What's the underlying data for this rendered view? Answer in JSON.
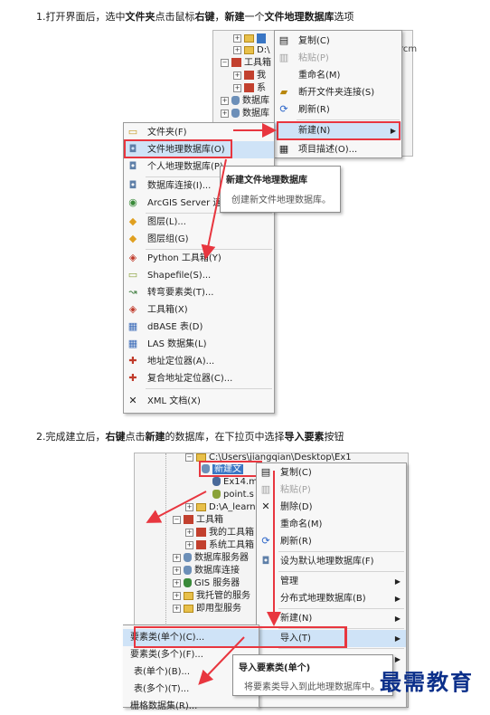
{
  "step1": {
    "caption_parts": [
      "1.打开界面后，选中",
      "文件夹",
      "点击鼠标",
      "右键",
      "，",
      "新建",
      "一个",
      "文件地理数据库",
      "选项"
    ],
    "tree_items": [
      "D:\\",
      "工具箱",
      "我",
      "系",
      "数据库",
      "数据库"
    ],
    "tree_right_text": "rcm",
    "context_menu": [
      {
        "label": "复制(C)",
        "icon": "copy-icon",
        "glyph": "▤",
        "disabled": false
      },
      {
        "label": "粘贴(P)",
        "icon": "paste-icon",
        "glyph": "▥",
        "disabled": true
      },
      {
        "label": "重命名(M)",
        "icon": "rename-icon",
        "glyph": "",
        "disabled": false
      },
      {
        "label": "断开文件夹连接(S)",
        "icon": "disconnect-icon",
        "glyph": "▰",
        "disabled": false
      },
      {
        "label": "刷新(R)",
        "icon": "refresh-icon",
        "glyph": "⟳",
        "disabled": false
      },
      {
        "label": "新建(N)",
        "icon": "",
        "glyph": "",
        "disabled": false
      },
      {
        "label": "项目描述(O)...",
        "icon": "description-icon",
        "glyph": "▦",
        "disabled": false
      }
    ],
    "submenu": [
      {
        "label": "文件夹(F)",
        "icon": "folder-icon",
        "glyph": "▭"
      },
      {
        "label": "文件地理数据库(O)",
        "icon": "file-gdb-icon",
        "glyph": "◘"
      },
      {
        "label": "个人地理数据库(P)",
        "icon": "personal-gdb-icon",
        "glyph": "◘"
      },
      {
        "label": "数据库连接(I)...",
        "icon": "db-connection-icon",
        "glyph": "◘"
      },
      {
        "label": "ArcGIS Server 连",
        "icon": "arcgis-server-icon",
        "glyph": "◉"
      },
      {
        "label": "图层(L)...",
        "icon": "layer-icon",
        "glyph": "◆"
      },
      {
        "label": "图层组(G)",
        "icon": "layer-group-icon",
        "glyph": "◆"
      },
      {
        "label": "Python 工具箱(Y)",
        "icon": "python-toolbox-icon",
        "glyph": "◈"
      },
      {
        "label": "Shapefile(S)...",
        "icon": "shapefile-icon",
        "glyph": "▭"
      },
      {
        "label": "转弯要素类(T)...",
        "icon": "turn-feature-icon",
        "glyph": "↝"
      },
      {
        "label": "工具箱(X)",
        "icon": "toolbox-icon",
        "glyph": "◈"
      },
      {
        "label": "dBASE 表(D)",
        "icon": "dbase-table-icon",
        "glyph": "▦"
      },
      {
        "label": "LAS 数据集(L)",
        "icon": "las-dataset-icon",
        "glyph": "▦"
      },
      {
        "label": "地址定位器(A)...",
        "icon": "locator-icon",
        "glyph": "✚"
      },
      {
        "label": "复合地址定位器(C)...",
        "icon": "composite-locator-icon",
        "glyph": "✚"
      },
      {
        "label": "XML 文档(X)",
        "icon": "xml-icon",
        "glyph": "✕"
      }
    ],
    "tooltip": {
      "title": "新建文件地理数据库",
      "desc": "创建新文件地理数据库。"
    }
  },
  "step2": {
    "caption_parts": [
      "2.完成建立后，",
      "右键",
      "点击",
      "新建",
      "的数据库，在下拉页中选择",
      "导入要素",
      "按钮"
    ],
    "tree": [
      {
        "label": "C:\\Users\\jiangqian\\Desktop\\Ex1"
      },
      {
        "label": "新建文"
      },
      {
        "label": "Ex14.m"
      },
      {
        "label": "point.s"
      },
      {
        "label": "D:\\A_learn"
      },
      {
        "label": "工具箱"
      },
      {
        "label": "我的工具箱"
      },
      {
        "label": "系统工具箱"
      },
      {
        "label": "数据库服务器"
      },
      {
        "label": "数据库连接"
      },
      {
        "label": "GIS 服务器"
      },
      {
        "label": "我托管的服务"
      },
      {
        "label": "即用型服务"
      }
    ],
    "context_menu": [
      {
        "label": "复制(C)",
        "icon": "copy-icon",
        "glyph": "▤",
        "disabled": false
      },
      {
        "label": "粘贴(P)",
        "icon": "paste-icon",
        "glyph": "▥",
        "disabled": true
      },
      {
        "label": "删除(D)",
        "icon": "delete-icon",
        "glyph": "✕",
        "disabled": false
      },
      {
        "label": "重命名(M)",
        "icon": "rename-icon",
        "glyph": "",
        "disabled": false
      },
      {
        "label": "刷新(R)",
        "icon": "refresh-icon",
        "glyph": "⟳",
        "disabled": false
      },
      {
        "label": "设为默认地理数据库(F)",
        "icon": "default-gdb-icon",
        "glyph": "◘",
        "disabled": false
      },
      {
        "label": "管理",
        "icon": "",
        "glyph": "",
        "disabled": false
      },
      {
        "label": "分布式地理数据库(B)",
        "icon": "",
        "glyph": "",
        "disabled": false
      },
      {
        "label": "新建(N)",
        "icon": "",
        "glyph": "",
        "disabled": false
      },
      {
        "label": "导入(T)",
        "icon": "",
        "glyph": "",
        "disabled": false
      }
    ],
    "left_submenu": [
      "要素类(单个)(C)...",
      "要素类(多个)(F)...",
      "表(单个)(B)...",
      "表(多个)(T)...",
      "栅格数据集(R)..."
    ],
    "tooltip": {
      "title": "导入要素类(单个)",
      "desc": "将要素类导入到此地理数据库中。"
    }
  },
  "watermark": "最需教育",
  "colors": {
    "red": "#e8363f",
    "highlight": "#cfe3f7",
    "watermark": "#0b2f8a"
  }
}
